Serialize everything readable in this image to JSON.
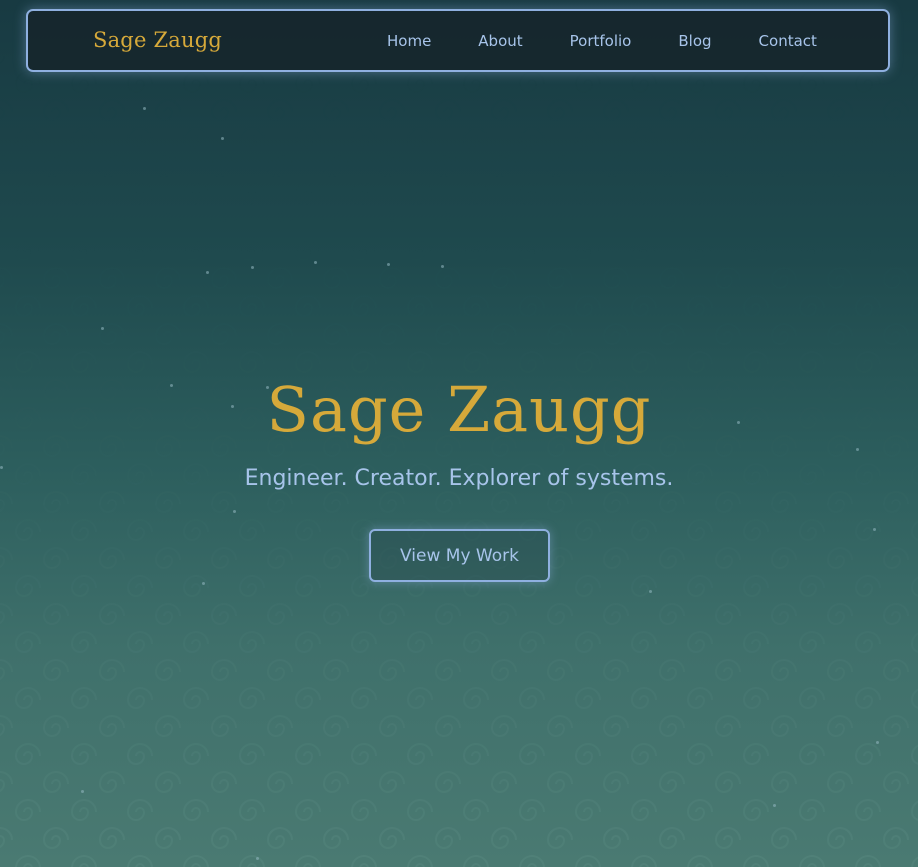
{
  "nav": {
    "brand": "Sage Zaugg",
    "links": [
      {
        "label": "Home"
      },
      {
        "label": "About"
      },
      {
        "label": "Portfolio"
      },
      {
        "label": "Blog"
      },
      {
        "label": "Contact"
      }
    ]
  },
  "hero": {
    "title": "Sage Zaugg",
    "tagline": "Engineer. Creator. Explorer of systems.",
    "cta_label": "View My Work"
  },
  "colors": {
    "gold": "#d6a93a",
    "link_blue": "#a7c4ea",
    "border_blue": "#8fb0e0"
  }
}
